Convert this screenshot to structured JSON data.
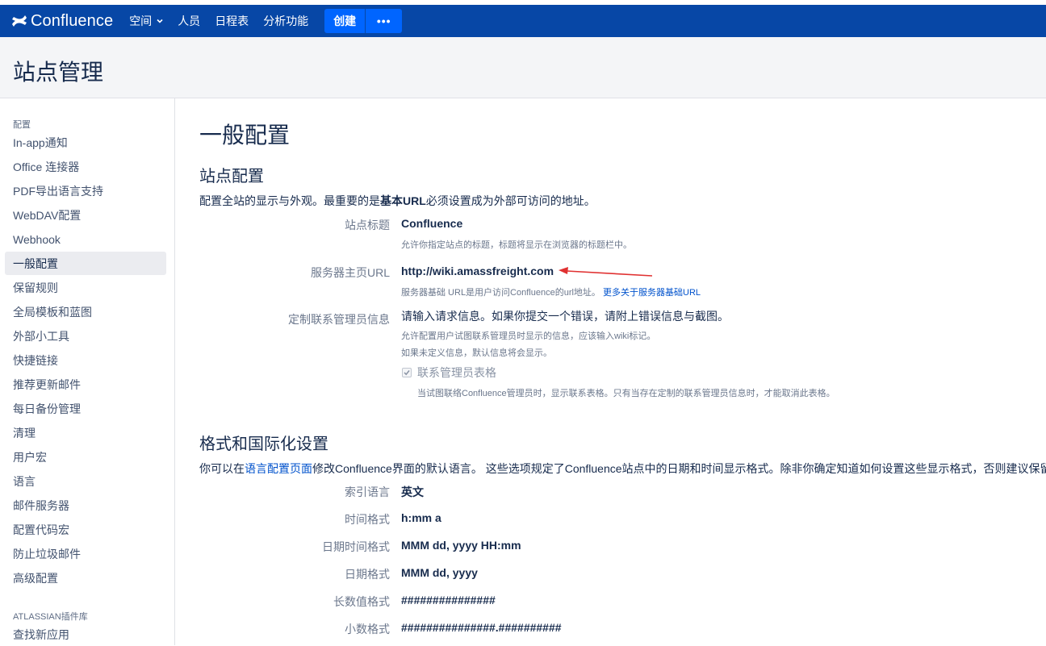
{
  "topbar": {
    "logo_text": "Confluence",
    "nav": [
      "空间",
      "人员",
      "日程表",
      "分析功能"
    ],
    "create_label": "创建",
    "more_label": "•••",
    "color": "#0747a6",
    "button_color": "#0065ff"
  },
  "page": {
    "title": "站点管理"
  },
  "sidebar": {
    "heading_config": "配置",
    "items": [
      "In-app通知",
      "Office 连接器",
      "PDF导出语言支持",
      "WebDAV配置",
      "Webhook",
      "一般配置",
      "保留规则",
      "全局模板和蓝图",
      "外部小工具",
      "快捷链接",
      "推荐更新邮件",
      "每日备份管理",
      "清理",
      "用户宏",
      "语言",
      "邮件服务器",
      "配置代码宏",
      "防止垃圾邮件",
      "高级配置"
    ],
    "active_item": "一般配置",
    "heading_plugins": "ATLASSIAN插件库",
    "plugin_items": [
      "查找新应用"
    ]
  },
  "main": {
    "title": "一般配置",
    "site_config": {
      "title": "站点配置",
      "desc_before": "配置全站的显示与外观。最重要的是",
      "desc_bold": "基本URL",
      "desc_after": "必须设置成为外部可访问的地址。",
      "site_title_label": "站点标题",
      "site_title_value": "Confluence",
      "site_title_help": "允许你指定站点的标题，标题将显示在浏览器的标题栏中。",
      "base_url_label": "服务器主页URL",
      "base_url_value": "http://wiki.amassfreight.com",
      "base_url_help": "服务器基础 URL是用户访问Confluence的url地址。",
      "base_url_link": "更多关于服务器基础URL",
      "contact_label": "定制联系管理员信息",
      "contact_value": "请输入请求信息。如果你提交一个错误，请附上错误信息与截图。",
      "contact_help1": "允许配置用户试图联系管理员时显示的信息，应该输入wiki标记。",
      "contact_help2": "如果未定义信息，默认信息将会显示。",
      "contact_form_label": "联系管理员表格",
      "contact_form_checked": true,
      "contact_form_help": "当试图联络Confluence管理员时，显示联系表格。只有当存在定制的联系管理员信息时，才能取消此表格。"
    },
    "i18n": {
      "title": "格式和国际化设置",
      "desc_before": "你可以在",
      "desc_link": "语言配置页面",
      "desc_after": "修改Confluence界面的默认语言。 这些选项规定了Confluence站点中的日期和时间显示格式。除非你确定知道如何设置这些显示格式，否则建议保留",
      "rows": [
        {
          "label": "索引语言",
          "value": "英文"
        },
        {
          "label": "时间格式",
          "value": "h:mm a"
        },
        {
          "label": "日期时间格式",
          "value": "MMM dd, yyyy HH:mm"
        },
        {
          "label": "日期格式",
          "value": "MMM dd, yyyy"
        },
        {
          "label": "长数值格式",
          "value": "###############"
        },
        {
          "label": "小数格式",
          "value": "###############.##########"
        }
      ]
    },
    "annotation_color": "#e03131"
  }
}
